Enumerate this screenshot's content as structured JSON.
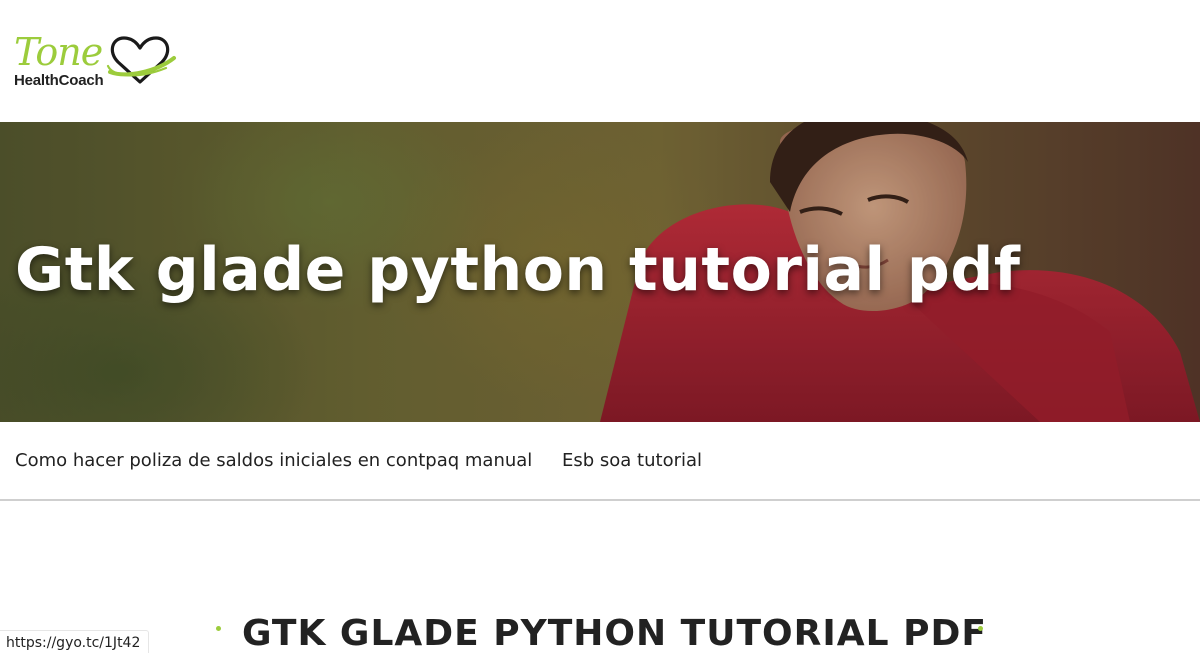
{
  "header": {
    "logo": {
      "name": "Tone",
      "tagline": "HealthCoach",
      "icon": "heart-icon",
      "brand_color": "#9ccc3c"
    }
  },
  "hero": {
    "title": "Gtk glade python tutorial pdf",
    "image": "woman-in-red-jacket-exercising-photo"
  },
  "nav": {
    "links": [
      {
        "label": "Como hacer poliza de saldos iniciales en contpaq manual"
      },
      {
        "label": "Esb soa tutorial"
      }
    ]
  },
  "main": {
    "section_title": "GTK GLADE PYTHON TUTORIAL PDF"
  },
  "status_bar": {
    "url": "https://gyo.tc/1Jt42"
  }
}
